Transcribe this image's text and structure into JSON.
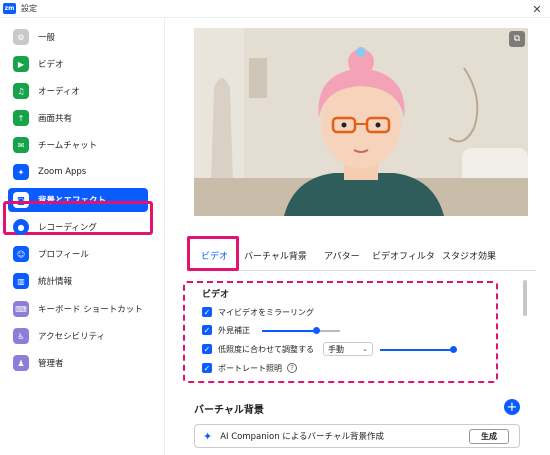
{
  "window": {
    "app_icon": "zm",
    "title": "設定",
    "close_label": "✕"
  },
  "sidebar": {
    "items": [
      {
        "label": "一般",
        "icon": "gear-icon",
        "color": "#c9c9c9"
      },
      {
        "label": "ビデオ",
        "icon": "video-icon",
        "color": "#17a34a"
      },
      {
        "label": "オーディオ",
        "icon": "headphones-icon",
        "color": "#17a34a"
      },
      {
        "label": "画面共有",
        "icon": "share-screen-icon",
        "color": "#17a34a"
      },
      {
        "label": "チームチャット",
        "icon": "chat-icon",
        "color": "#17a34a"
      },
      {
        "label": "Zoom Apps",
        "icon": "apps-icon",
        "color": "#0b5cff"
      },
      {
        "label": "背景とエフェクト",
        "icon": "background-icon",
        "color": "#0b5cff"
      },
      {
        "label": "レコーディング",
        "icon": "record-icon",
        "color": "#0b5cff"
      },
      {
        "label": "プロフィール",
        "icon": "profile-icon",
        "color": "#0b5cff"
      },
      {
        "label": "統計情報",
        "icon": "stats-icon",
        "color": "#0b5cff"
      },
      {
        "label": "キーボード ショートカット",
        "icon": "keyboard-icon",
        "color": "#8b7fd8"
      },
      {
        "label": "アクセシビリティ",
        "icon": "accessibility-icon",
        "color": "#8b7fd8"
      },
      {
        "label": "管理者",
        "icon": "admin-icon",
        "color": "#8b7fd8"
      }
    ]
  },
  "tabs": [
    {
      "label": "ビデオ"
    },
    {
      "label": "バーチャル背景"
    },
    {
      "label": "アバター"
    },
    {
      "label": "ビデオフィルタ"
    },
    {
      "label": "スタジオ効果"
    }
  ],
  "video_section": {
    "title": "ビデオ",
    "options": [
      {
        "label": "マイビデオをミラーリング",
        "checked": true
      },
      {
        "label": "外見補正",
        "checked": true,
        "slider_value_percent": 68
      },
      {
        "label": "低照度に合わせて調整する",
        "checked": true,
        "mode": "手動",
        "slider_value_percent": 100
      },
      {
        "label": "ポートレート照明",
        "checked": true,
        "help": "?"
      }
    ]
  },
  "virtual_bg": {
    "title": "バーチャル背景",
    "add": "+",
    "ai_text": "AI Companion によるバーチャル背景作成",
    "generate_label": "生成"
  },
  "colors": {
    "accent": "#0b5cff",
    "highlight": "#e2136e"
  }
}
